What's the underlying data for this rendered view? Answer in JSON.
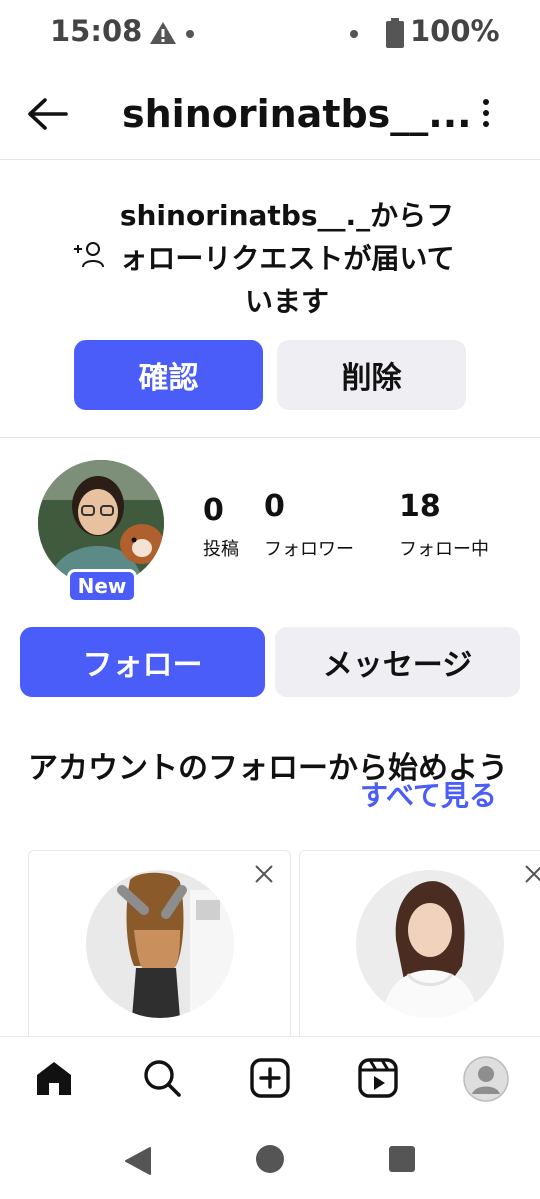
{
  "status_bar": {
    "time": "15:08",
    "battery_percent": "100%",
    "icons": [
      "warning-icon",
      "notification-dot-icon",
      "battery-icon"
    ]
  },
  "header": {
    "title": "shinorinatbs__...",
    "back_icon": "back-arrow-icon",
    "menu_icon": "more-vert-icon"
  },
  "follow_request": {
    "icon": "person-add-icon",
    "message": "shinorinatbs__._からフォローリクエストが届いています",
    "confirm_label": "確認",
    "delete_label": "削除"
  },
  "profile": {
    "new_badge": "New",
    "stats": [
      {
        "value": "0",
        "label": "投稿"
      },
      {
        "value": "0",
        "label": "フォロワー"
      },
      {
        "value": "18",
        "label": "フォロー中"
      }
    ],
    "follow_label": "フォロー",
    "message_label": "メッセージ"
  },
  "suggestions": {
    "title": "アカウントのフォローから始めよう",
    "see_all_label": "すべて見る"
  },
  "bottom_nav": {
    "items": [
      "home-icon",
      "search-icon",
      "create-icon",
      "reels-icon",
      "profile-icon"
    ]
  },
  "system_nav": {
    "items": [
      "back-triangle-icon",
      "home-circle-icon",
      "recents-square-icon"
    ]
  },
  "colors": {
    "accent": "#4a5df9",
    "secondary_button": "#efeff3",
    "text": "#111111"
  }
}
